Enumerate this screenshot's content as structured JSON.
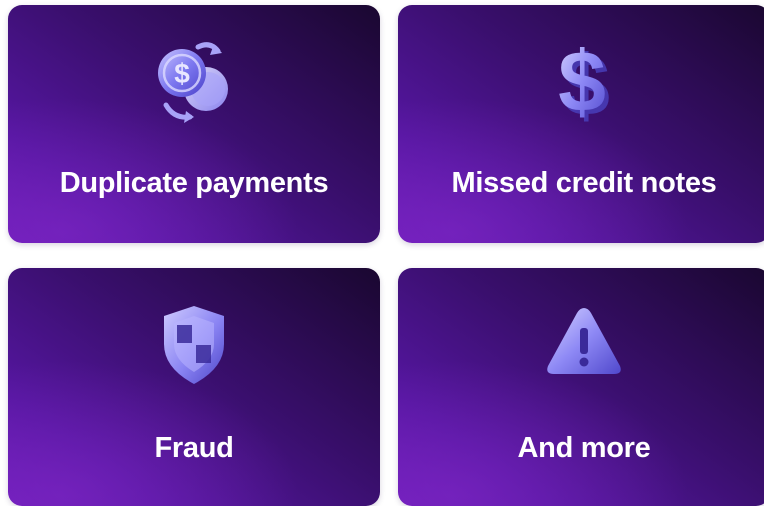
{
  "cards": [
    {
      "label": "Duplicate payments",
      "icon": "coin-exchange-icon"
    },
    {
      "label": "Missed credit notes",
      "icon": "dollar-sign-icon"
    },
    {
      "label": "Fraud",
      "icon": "shield-icon"
    },
    {
      "label": "And more",
      "icon": "warning-triangle-icon"
    }
  ],
  "colors": {
    "card_dark": "#1a0730",
    "card_mid": "#3a0f6e",
    "card_light": "#6b1cb8",
    "icon_fill": "#7f7bf0",
    "icon_highlight": "#c8c4ff",
    "text": "#ffffff"
  }
}
